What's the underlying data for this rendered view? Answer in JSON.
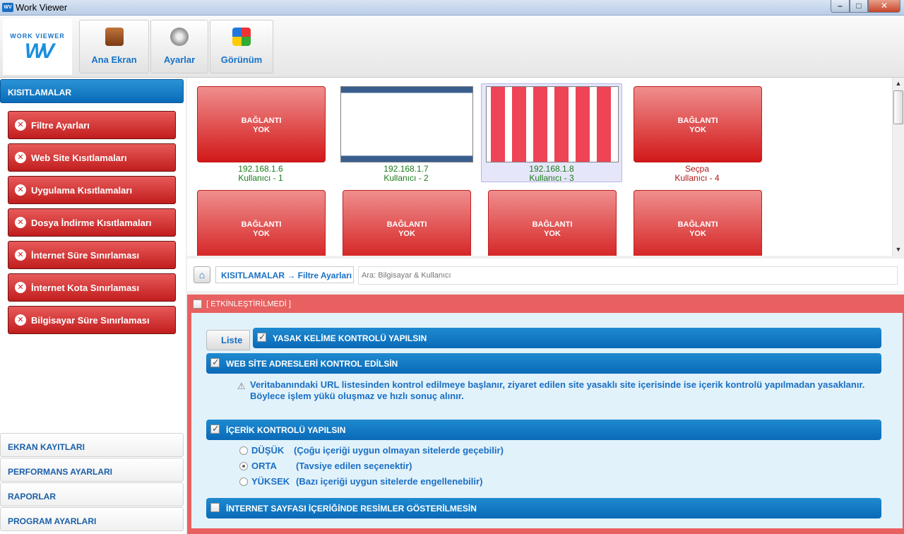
{
  "window": {
    "title": "Work Viewer",
    "logo_top": "WORK VIEWER",
    "logo_mark": "WV"
  },
  "toolbar": [
    {
      "label": "Ana Ekran",
      "icon": "briefcase-icon"
    },
    {
      "label": "Ayarlar",
      "icon": "gears-icon"
    },
    {
      "label": "Görünüm",
      "icon": "rubiks-cube-icon"
    }
  ],
  "sidebar": {
    "active_header": "KISITLAMALAR",
    "items": [
      "Filtre Ayarları",
      "Web Site Kısıtlamaları",
      "Uygulama Kısıtlamaları",
      "Dosya İndirme Kısıtlamaları",
      "İnternet Süre Sınırlaması",
      "İnternet Kota Sınırlaması",
      "Bilgisayar Süre Sınırlaması"
    ],
    "sections": [
      "EKRAN KAYITLARI",
      "PERFORMANS AYARLARI",
      "RAPORLAR",
      "PROGRAM AYARLARI"
    ]
  },
  "computers": [
    {
      "state": "BAĞLANTI YOK",
      "line1": "192.168.1.6",
      "line2": "Kullanıcı - 1",
      "status": "ok",
      "screenshot": false,
      "selected": false
    },
    {
      "state": "",
      "line1": "192.168.1.7",
      "line2": "Kullanıcı - 2",
      "status": "ok",
      "screenshot": true,
      "selected": false
    },
    {
      "state": "",
      "line1": "192.168.1.8",
      "line2": "Kullanıcı - 3",
      "status": "ok",
      "screenshot": true,
      "selected": true
    },
    {
      "state": "BAĞLANTI YOK",
      "line1": "Seçpa",
      "line2": "Kullanıcı - 4",
      "status": "bad",
      "screenshot": false,
      "selected": false
    },
    {
      "state": "BAĞLANTI YOK",
      "line1": "",
      "line2": "",
      "status": "ok",
      "screenshot": false,
      "selected": false
    },
    {
      "state": "BAĞLANTI YOK",
      "line1": "",
      "line2": "",
      "status": "ok",
      "screenshot": false,
      "selected": false
    },
    {
      "state": "BAĞLANTI YOK",
      "line1": "",
      "line2": "",
      "status": "ok",
      "screenshot": false,
      "selected": false
    },
    {
      "state": "BAĞLANTI YOK",
      "line1": "",
      "line2": "",
      "status": "ok",
      "screenshot": false,
      "selected": false
    }
  ],
  "breadcrumb": {
    "path": "KISITLAMALAR → Filtre Ayarları",
    "search_placeholder": "Ara: Bilgisayar & Kullanıcı"
  },
  "panel": {
    "enabled_label": "[ ETKİNLEŞTİRİLMEDİ ]",
    "liste_label": "Liste",
    "opt_banned_words": "YASAK KELİME KONTROLÜ YAPILSIN",
    "opt_web_sites": "WEB SİTE ADRESLERİ KONTROL EDİLSİN",
    "web_desc": "Veritabanındaki URL listesinden kontrol edilmeye başlanır, ziyaret edilen site yasaklı site içerisinde ise içerik kontrolü yapılmadan yasaklanır. Böylece işlem yükü oluşmaz ve hızlı sonuç alınır.",
    "opt_content": "İÇERİK KONTROLÜ YAPILSIN",
    "levels": [
      {
        "name": "DÜŞÜK",
        "desc": "(Çoğu içeriği uygun olmayan sitelerde geçebilir)",
        "checked": false
      },
      {
        "name": "ORTA",
        "desc": "(Tavsiye edilen seçenektir)",
        "checked": true
      },
      {
        "name": "YÜKSEK",
        "desc": "(Bazı içeriği uygun sitelerde engellenebilir)",
        "checked": false
      }
    ],
    "opt_images": "İNTERNET SAYFASI İÇERİĞİNDE RESİMLER GÖSTERİLMESİN"
  },
  "colors": {
    "accent": "#0a6bb8",
    "danger": "#c21d1d",
    "panel_bg": "#e86060",
    "inner_bg": "#e2f2fa"
  }
}
